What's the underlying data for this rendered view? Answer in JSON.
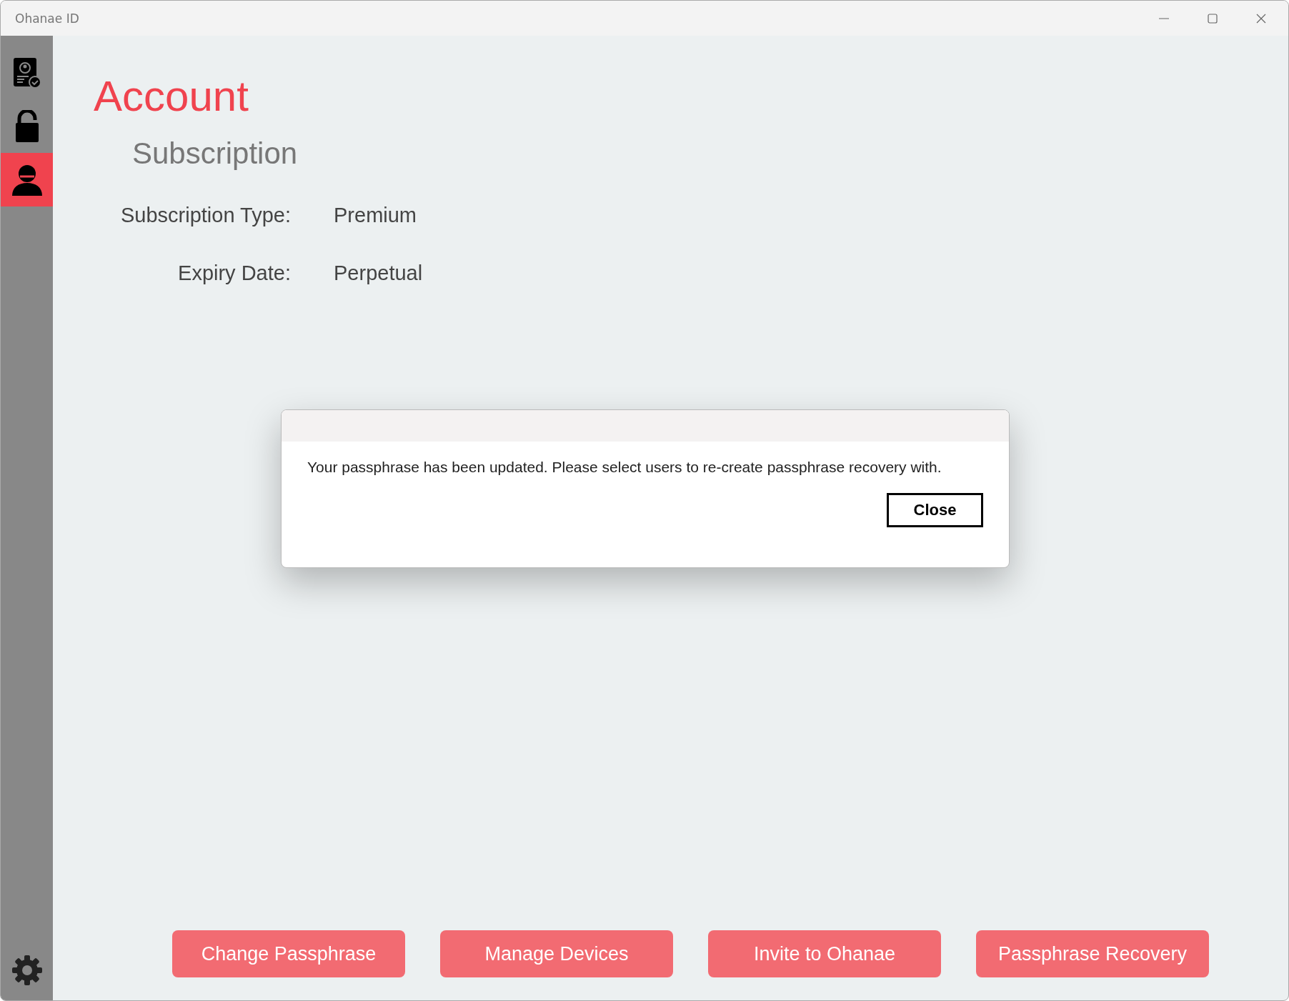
{
  "window": {
    "title": "Ohanae ID"
  },
  "sidebar": {
    "items": [
      {
        "kind": "id-card",
        "selected": false
      },
      {
        "kind": "lock",
        "selected": false
      },
      {
        "kind": "person",
        "selected": true
      }
    ]
  },
  "page": {
    "title": "Account",
    "section": "Subscription",
    "fields": [
      {
        "label": "Subscription Type:",
        "value": "Premium"
      },
      {
        "label": "Expiry Date:",
        "value": "Perpetual"
      }
    ]
  },
  "dialog": {
    "message": "Your passphrase has been updated. Please select users to re-create passphrase recovery with.",
    "button": "Close"
  },
  "actions": [
    "Change Passphrase",
    "Manage Devices",
    "Invite to Ohanae",
    "Passphrase Recovery"
  ]
}
